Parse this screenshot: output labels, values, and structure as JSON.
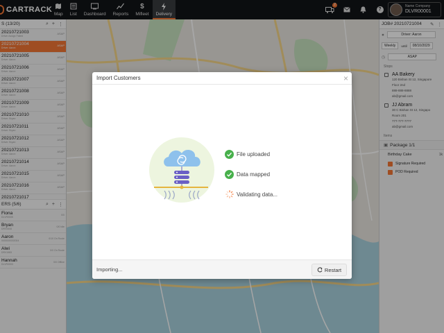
{
  "brand": {
    "name": "CARTRACK",
    "tagline": "PARTNER FOR EN TRACKING"
  },
  "nav": [
    {
      "label": "Map",
      "icon": "map-icon"
    },
    {
      "label": "List",
      "icon": "list-icon"
    },
    {
      "label": "Dashboard",
      "icon": "dashboard-icon"
    },
    {
      "label": "Reports",
      "icon": "reports-icon"
    },
    {
      "label": "Mifleet",
      "icon": "dollar-icon"
    },
    {
      "label": "Delivery",
      "icon": "bolt-icon",
      "active": true
    }
  ],
  "top_icons": {
    "notification_count": "2"
  },
  "user": {
    "company": "Name Company",
    "id": "DLVR00001"
  },
  "jobs_panel": {
    "header": "S (13/20)",
    "jobs": [
      {
        "id": "20210721003",
        "sub": "Driver Assign Failed",
        "tag": "ASAP"
      },
      {
        "id": "20210721004",
        "sub": "Driver: Aaron",
        "tag": "ASAP",
        "selected": true
      },
      {
        "id": "20210721005",
        "sub": "Driver: Aaron",
        "tag": "ASAP"
      },
      {
        "id": "20210721006",
        "sub": "Driver: Aaron",
        "tag": "ASAP"
      },
      {
        "id": "20210721007",
        "sub": "Driver: Aaron",
        "tag": "ASAP"
      },
      {
        "id": "20210721008",
        "sub": "Driver: Aaron",
        "tag": "ASAP"
      },
      {
        "id": "20210721009",
        "sub": "Driver: Aaron",
        "tag": "ASAP"
      },
      {
        "id": "20210721010",
        "sub": "Driver: Bryan",
        "tag": "ASAP"
      },
      {
        "id": "20210721011",
        "sub": "Driver: Bryan",
        "tag": "ASAP"
      },
      {
        "id": "20210721012",
        "sub": "Driver: Bryan",
        "tag": "ASAP"
      },
      {
        "id": "20210721013",
        "sub": "Driver: Aaron",
        "tag": "ASAP"
      },
      {
        "id": "20210721014",
        "sub": "Driver: Aaron",
        "tag": "ASAP"
      },
      {
        "id": "20210721015",
        "sub": "Driver: Aaron",
        "tag": "ASAP"
      },
      {
        "id": "20210721016",
        "sub": "Driver: Aaron",
        "tag": "ASAP"
      },
      {
        "id": "20210721017",
        "sub": "",
        "tag": ""
      }
    ]
  },
  "drivers_panel": {
    "header": "ERS (5/6)",
    "drivers": [
      {
        "name": "Fiona",
        "id": "DLVR0005",
        "status": "0/0"
      },
      {
        "name": "Bryan",
        "id": "DRV0006",
        "status": "0/0 Idle"
      },
      {
        "name": "Aaron",
        "id": "0000000002004",
        "status": "0/10 On Route"
      },
      {
        "name": "Alwi",
        "id": "DRV1983",
        "status": "0/0 On Route"
      },
      {
        "name": "Hannah",
        "id": "DLVR0003",
        "status": "0/0 Offline"
      }
    ]
  },
  "job_detail": {
    "header": "JOB# 20210721004",
    "driver": "Driver: Aaron",
    "repeat": "Weekly",
    "until_label": "until",
    "until_date": "08/10/2029",
    "priority": "ASAP",
    "stops_label": "Stops",
    "stops": [
      {
        "title": "AA Bakery",
        "lines": [
          "120 Bishan St 12, Singapore",
          "Floor 2nd",
          "888-888-8888",
          "ab@gmail.com"
        ]
      },
      {
        "title": "JJ Abram",
        "lines": [
          "30 C Bishan St 12, Singapo",
          "Room 201",
          "777-777-7777",
          "ab@gmail.com"
        ]
      }
    ],
    "items_label": "Items",
    "package_title": "Package 1/1",
    "package_item": "Birthday Cake",
    "package_qty": "1k",
    "checks": [
      "Signature Required",
      "POD Required"
    ]
  },
  "dialog": {
    "title": "Import Customers",
    "steps": [
      {
        "label": "File uploaded",
        "state": "done"
      },
      {
        "label": "Data mapped",
        "state": "done"
      },
      {
        "label": "Validating data...",
        "state": "loading"
      }
    ],
    "status": "Importing...",
    "restart_label": "Restart"
  },
  "colors": {
    "accent": "#f47735",
    "success": "#47b04b",
    "topbar": "#121417",
    "cloud": "#8ec1ec",
    "db_stack": "#6a5fc5"
  }
}
